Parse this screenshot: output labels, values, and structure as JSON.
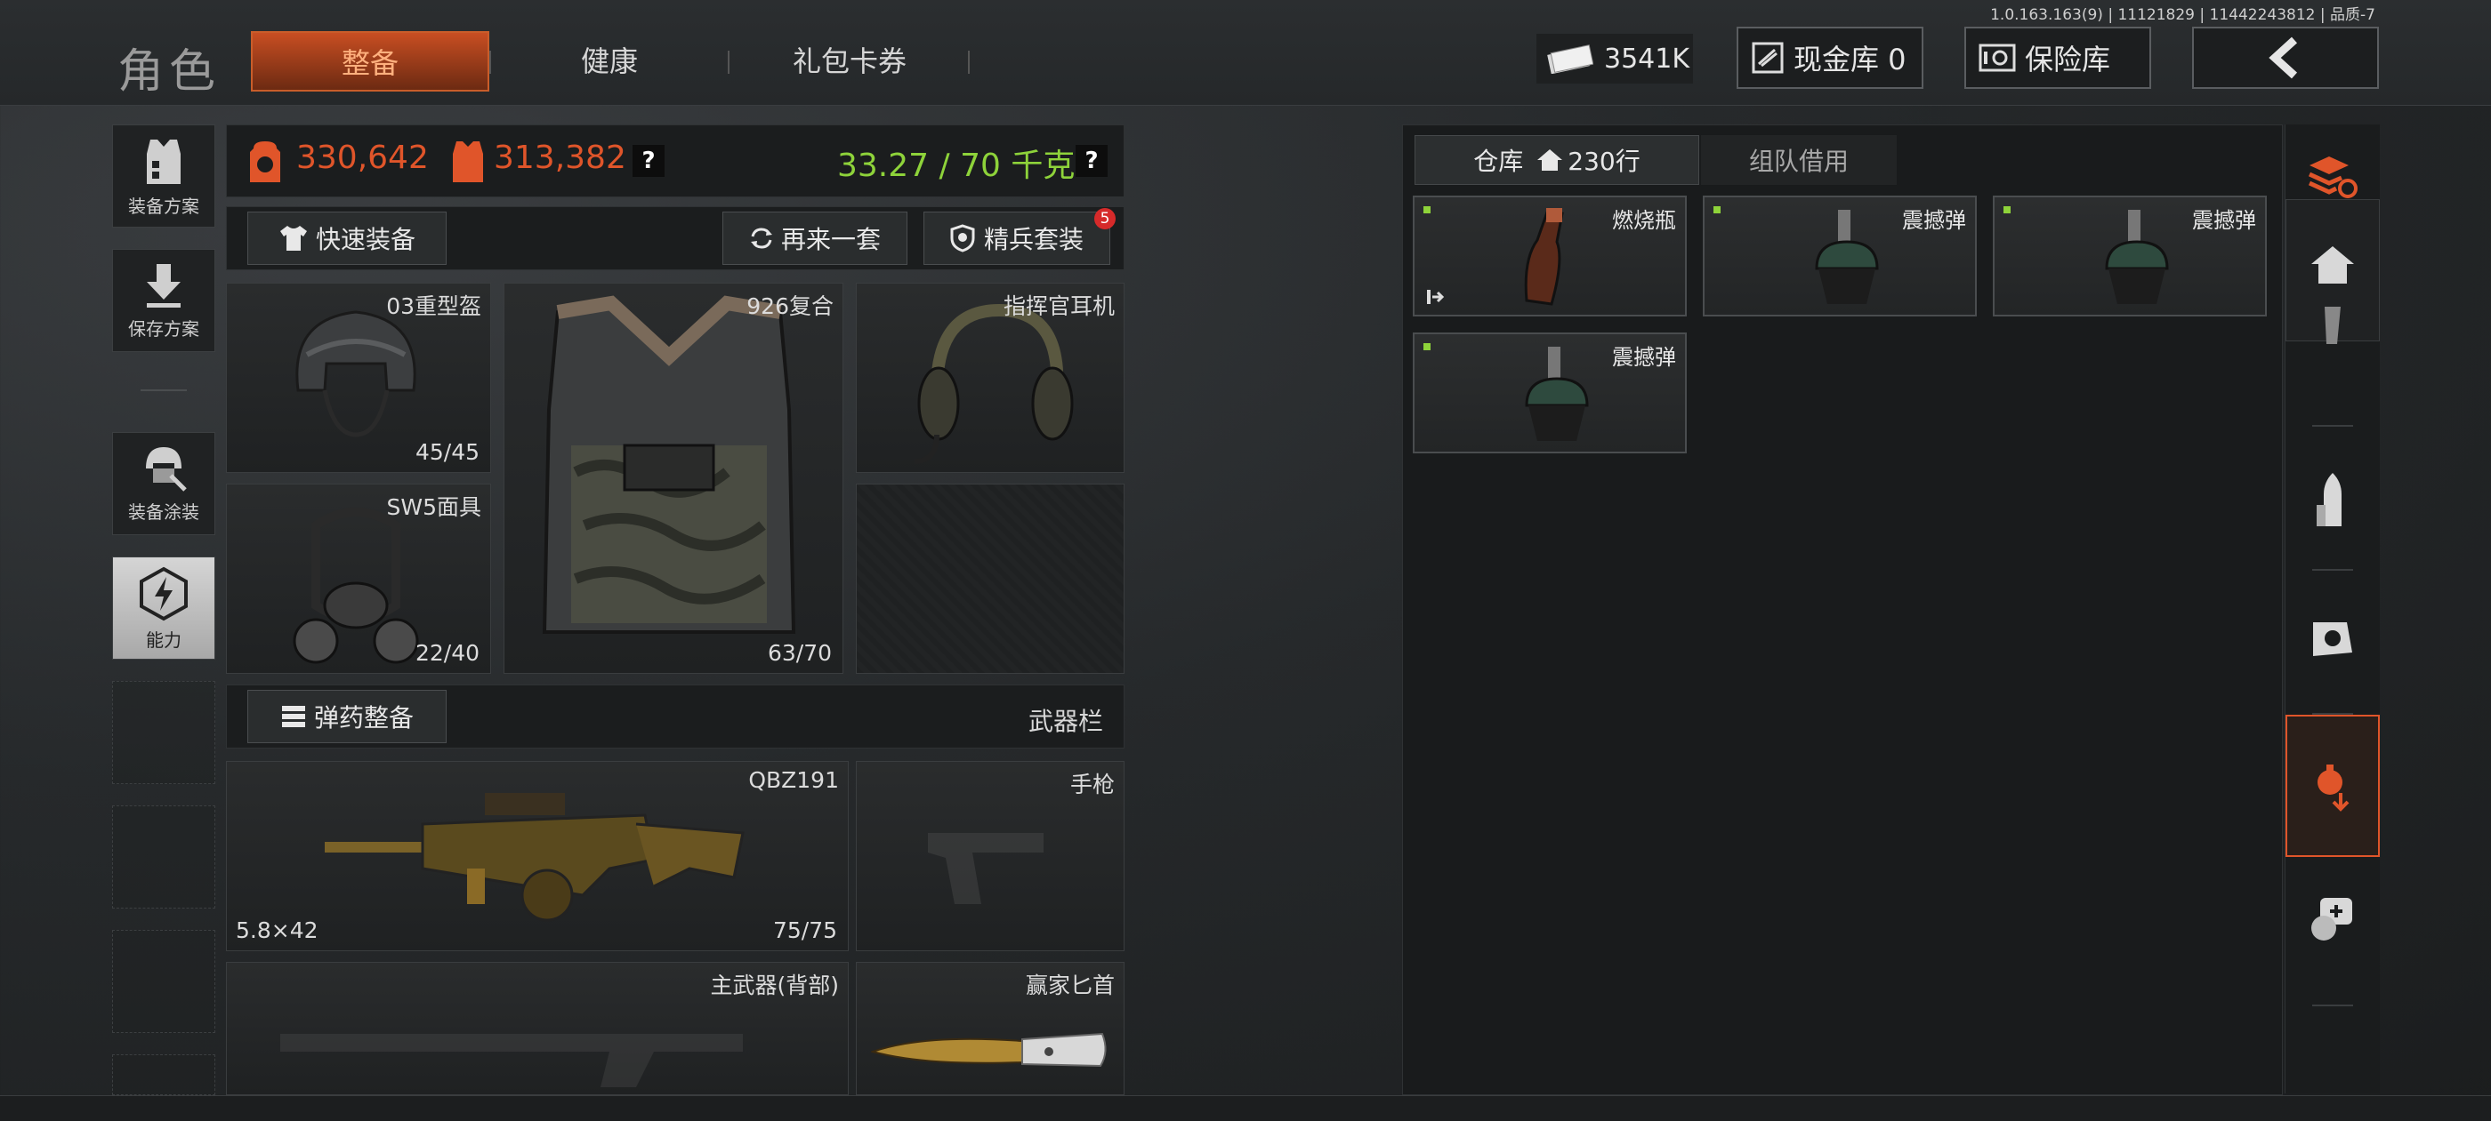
{
  "version": "1.0.163.163(9) | 11121829 | 11442243812 | 品质-7",
  "header": {
    "title": "角色",
    "tabs": [
      {
        "label": "整备",
        "active": true
      },
      {
        "label": "健康",
        "active": false
      },
      {
        "label": "礼包卡券",
        "active": false
      }
    ],
    "cash": "3541K",
    "cash_vault": "现金库 0",
    "safe_vault": "保险库"
  },
  "sidebar": {
    "items": [
      {
        "label": "装备方案"
      },
      {
        "label": "保存方案"
      },
      {
        "label": "装备涂装"
      },
      {
        "label": "能力"
      }
    ]
  },
  "stats": {
    "value_a": "330,642",
    "value_b": "313,382",
    "weight": "33.27 / 70 千克",
    "help": "?"
  },
  "actions": {
    "quick_equip": "快速装备",
    "again": "再来一套",
    "elite": "精兵套装",
    "elite_badge": "5",
    "ammo_equip": "弹药整备",
    "weapon_bar": "武器栏"
  },
  "slots": {
    "helmet": {
      "name": "03重型盔",
      "durability": "45/45"
    },
    "armor": {
      "name": "926复合",
      "durability": "63/70"
    },
    "headset": {
      "name": "指挥官耳机"
    },
    "mask": {
      "name": "SW5面具",
      "durability": "22/40"
    },
    "primary": {
      "name": "QBZ191",
      "ammo": "5.8×42",
      "count": "75/75"
    },
    "pistol": {
      "name": "手枪"
    },
    "back_weapon": {
      "name": "主武器(背部)"
    },
    "knife": {
      "name": "赢家匕首"
    }
  },
  "storage": {
    "tabs": [
      {
        "label": "仓库",
        "extra": "230行",
        "active": true
      },
      {
        "label": "组队借用",
        "active": false
      }
    ],
    "items": [
      {
        "name": "燃烧瓶"
      },
      {
        "name": "震撼弹"
      },
      {
        "name": "震撼弹"
      },
      {
        "name": "震撼弹"
      }
    ]
  },
  "colors": {
    "accent_orange": "#e0552a",
    "weight_green": "#8ed33a"
  }
}
